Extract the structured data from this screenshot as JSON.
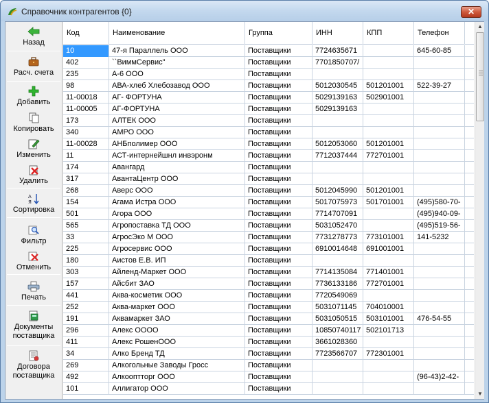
{
  "window": {
    "title": "Справочник контрагентов {0}",
    "close_glyph": "✕"
  },
  "toolbar": {
    "buttons": [
      {
        "label": "Назад",
        "icon": "arrow-left-icon"
      },
      {
        "label": "Расч. счета",
        "icon": "briefcase-icon"
      },
      {
        "label": "Добавить",
        "icon": "plus-icon"
      },
      {
        "label": "Копировать",
        "icon": "copy-icon"
      },
      {
        "label": "Изменить",
        "icon": "edit-icon"
      },
      {
        "label": "Удалить",
        "icon": "delete-icon"
      },
      {
        "label": "Сортировка",
        "icon": "sort-icon"
      },
      {
        "label": "Фильтр",
        "icon": "filter-icon"
      },
      {
        "label": "Отменить",
        "icon": "cancel-filter-icon"
      },
      {
        "label": "Печать",
        "icon": "printer-icon"
      },
      {
        "label1": "Документы",
        "label2": "поставщика",
        "icon": "documents-icon"
      },
      {
        "label1": "Договора",
        "label2": "поставщика",
        "icon": "contracts-icon"
      }
    ]
  },
  "grid": {
    "columns": [
      "Код",
      "Наименование",
      "Группа",
      "ИНН",
      "КПП",
      "Телефон"
    ],
    "rows": [
      [
        "10",
        "47-я Параллель ООО",
        "Поставщики",
        "7724635671",
        "",
        "645-60-85"
      ],
      [
        "402",
        "``ВиммСервис\"",
        "Поставщики",
        "7701850707/",
        "",
        ""
      ],
      [
        "235",
        "А-6 ООО",
        "Поставщики",
        "",
        "",
        ""
      ],
      [
        "98",
        "АВА-хлеб Хлебозавод ООО",
        "Поставщики",
        "5012030545",
        "501201001",
        "522-39-27"
      ],
      [
        "11-00018",
        "АГ- ФОРТУНА",
        "Поставщики",
        "5029139163",
        "502901001",
        ""
      ],
      [
        "11-00005",
        "АГ-ФОРТУНА",
        "Поставщики",
        "5029139163",
        "",
        ""
      ],
      [
        "173",
        "АЛТЕК ООО",
        "Поставщики",
        "",
        "",
        ""
      ],
      [
        "340",
        "АМРО ООО",
        "Поставщики",
        "",
        "",
        ""
      ],
      [
        "11-00028",
        "АНБполимер ООО",
        "Поставщики",
        "5012053060",
        "501201001",
        ""
      ],
      [
        "11",
        "АСТ-интернейшнл инвэронм",
        "Поставщики",
        "7712037444",
        "772701001",
        ""
      ],
      [
        "174",
        "Авангард",
        "Поставщики",
        "",
        "",
        ""
      ],
      [
        "317",
        "АвантаЦентр ООО",
        "Поставщики",
        "",
        "",
        ""
      ],
      [
        "268",
        "Аверс ООО",
        "Поставщики",
        "5012045990",
        "501201001",
        ""
      ],
      [
        "154",
        "Агама Истра ООО",
        "Поставщики",
        "5017075973",
        "501701001",
        "(495)580-70-"
      ],
      [
        "501",
        "Агора ООО",
        "Поставщики",
        "7714707091",
        "",
        "(495)940-09-"
      ],
      [
        "565",
        "Агропоставка ТД ООО",
        "Поставщики",
        "5031052470",
        "",
        "(495)519-56-"
      ],
      [
        "33",
        "АгросЭко М ООО",
        "Поставщики",
        "7731278773",
        "773101001",
        "141-5232"
      ],
      [
        "225",
        "Агросервис ООО",
        "Поставщики",
        "6910014648",
        "691001001",
        ""
      ],
      [
        "180",
        "Аистов Е.В. ИП",
        "Поставщики",
        "",
        "",
        ""
      ],
      [
        "303",
        "Айленд-Маркет ООО",
        "Поставщики",
        "7714135084",
        "771401001",
        ""
      ],
      [
        "157",
        "Айсбит ЗАО",
        "Поставщики",
        "7736133186",
        "772701001",
        ""
      ],
      [
        "441",
        "Аква-косметик ООО",
        "Поставщики",
        "7720549069",
        "",
        ""
      ],
      [
        "252",
        "Аква-маркет ООО",
        "Поставщики",
        "5031071145",
        "704010001",
        ""
      ],
      [
        "191",
        "Аквамаркет ЗАО",
        "Поставщики",
        "5031050515",
        "503101001",
        "476-54-55"
      ],
      [
        "296",
        "Алекс ОООО",
        "Поставщики",
        "10850740117",
        "502101713",
        ""
      ],
      [
        "411",
        "Алекс РошенООО",
        "Поставщики",
        "3661028360",
        "",
        ""
      ],
      [
        "34",
        "Алко Бренд ТД",
        "Поставщики",
        "7723566707",
        "772301001",
        ""
      ],
      [
        "269",
        "Алкогольные Заводы Гросс",
        "Поставщики",
        "",
        "",
        ""
      ],
      [
        "492",
        "Алкооптторг ООО",
        "Поставщики",
        "",
        "",
        "(96-43)2-42-"
      ],
      [
        "101",
        "Аллигатор ООО",
        "Поставщики",
        "",
        "",
        ""
      ]
    ]
  },
  "colors": {
    "selection": "#3399ff",
    "grid_lines": "#c8d3e0",
    "toolbar_bg": "#f0f0f0"
  }
}
